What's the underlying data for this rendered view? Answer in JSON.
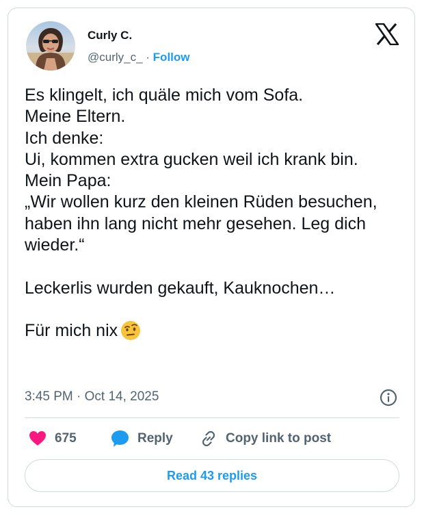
{
  "author": {
    "display_name": "Curly C.",
    "handle": "@curly_c_",
    "separator": " · ",
    "follow_label": "Follow"
  },
  "tweet": {
    "text": "Es klingelt, ich quäle mich vom Sofa.\nMeine Eltern.\nIch denke:\nUi, kommen extra gucken weil ich krank bin. Mein Papa:\n„Wir wollen kurz den kleinen Rüden besuchen, haben ihn lang nicht mehr gesehen. Leg dich wieder.“\n\nLeckerlis wurden gekauft, Kauknochen…\n\nFür mich nix",
    "emoji": "face-with-raised-eyebrow",
    "timestamp": "3:45 PM · Oct 14, 2025"
  },
  "actions": {
    "like_count": "675",
    "reply_label": "Reply",
    "copy_label": "Copy link to post"
  },
  "footer": {
    "read_replies_label": "Read 43 replies"
  },
  "colors": {
    "accent": "#1d9bf0",
    "like": "#f91880",
    "secondary_text": "#536471",
    "border": "#cfd9de"
  },
  "icons": [
    "x-logo-icon",
    "info-icon",
    "heart-icon",
    "reply-bubble-icon",
    "link-icon",
    "raised-eyebrow-emoji-icon"
  ]
}
